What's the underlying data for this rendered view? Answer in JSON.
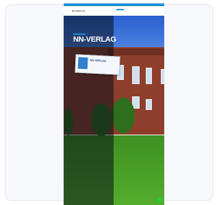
{
  "preview": {
    "topbar": {
      "text": "",
      "cta": ""
    },
    "header": {
      "logo": "NN-VERLAG",
      "logo_sub": "",
      "nav": [
        "",
        "",
        "",
        "",
        ""
      ]
    },
    "hero": {
      "title": "NN-VERLAG",
      "subtitle": "",
      "sign_title": "NN-VERLAG",
      "sign_sub": ""
    }
  },
  "colors": {
    "accent": "#1e90d6",
    "fab": "#28c840",
    "brick": "#8e3f2c",
    "grass": "#55ad2c"
  },
  "icons": {
    "fab": "whatsapp-chat-icon"
  }
}
